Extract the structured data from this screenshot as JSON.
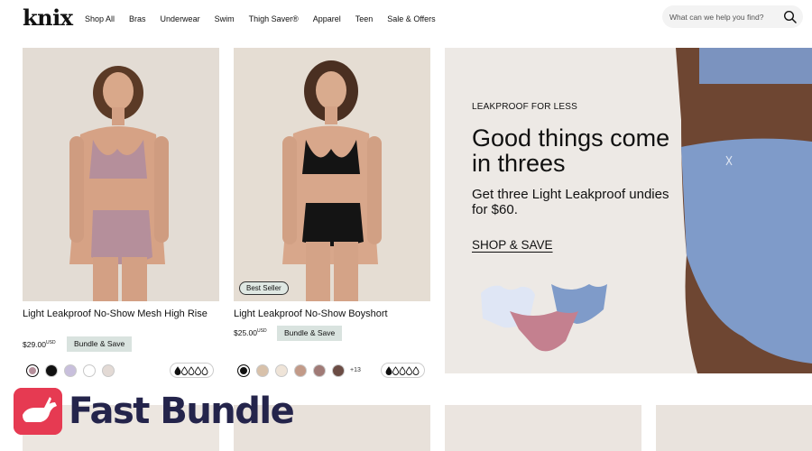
{
  "header": {
    "logo": "knix",
    "nav": [
      "Shop All",
      "Bras",
      "Underwear",
      "Swim",
      "Thigh Saver®",
      "Apparel",
      "Teen",
      "Sale & Offers"
    ],
    "search": {
      "placeholder": "What can we help you find?",
      "icon": "search-icon"
    }
  },
  "products": [
    {
      "title": "Light Leakproof No-Show Mesh High Rise",
      "price": "$29.00",
      "currency": "USD",
      "bundle_label": "Bundle & Save",
      "badge": "",
      "swatches": [
        "#b58f9b",
        "#111111",
        "#c8bfdc",
        "#ffffff",
        "#e3dad5"
      ],
      "more_colors": "",
      "absorbency_level": 1,
      "absorbency_max": 5
    },
    {
      "title": "Light Leakproof No-Show Boyshort",
      "price": "$25.00",
      "currency": "USD",
      "bundle_label": "Bundle & Save",
      "badge": "Best Seller",
      "swatches": [
        "#111111",
        "#d8c1aa",
        "#efe4d8",
        "#c29a88",
        "#a07a76",
        "#6b4c44"
      ],
      "more_colors": "+13",
      "absorbency_level": 1,
      "absorbency_max": 5
    }
  ],
  "promo": {
    "eyebrow": "LEAKPROOF FOR LESS",
    "headline": "Good things come in threes",
    "subtext": "Get three Light Leakproof undies for $60.",
    "cta": "SHOP & SAVE"
  },
  "overlay": {
    "brand": "Fast Bundle"
  },
  "colors": {
    "bundle_bg": "#d9e3df",
    "promo_bg": "#ede9e5",
    "overlay_accent": "#e63a52",
    "overlay_text": "#24244b"
  }
}
